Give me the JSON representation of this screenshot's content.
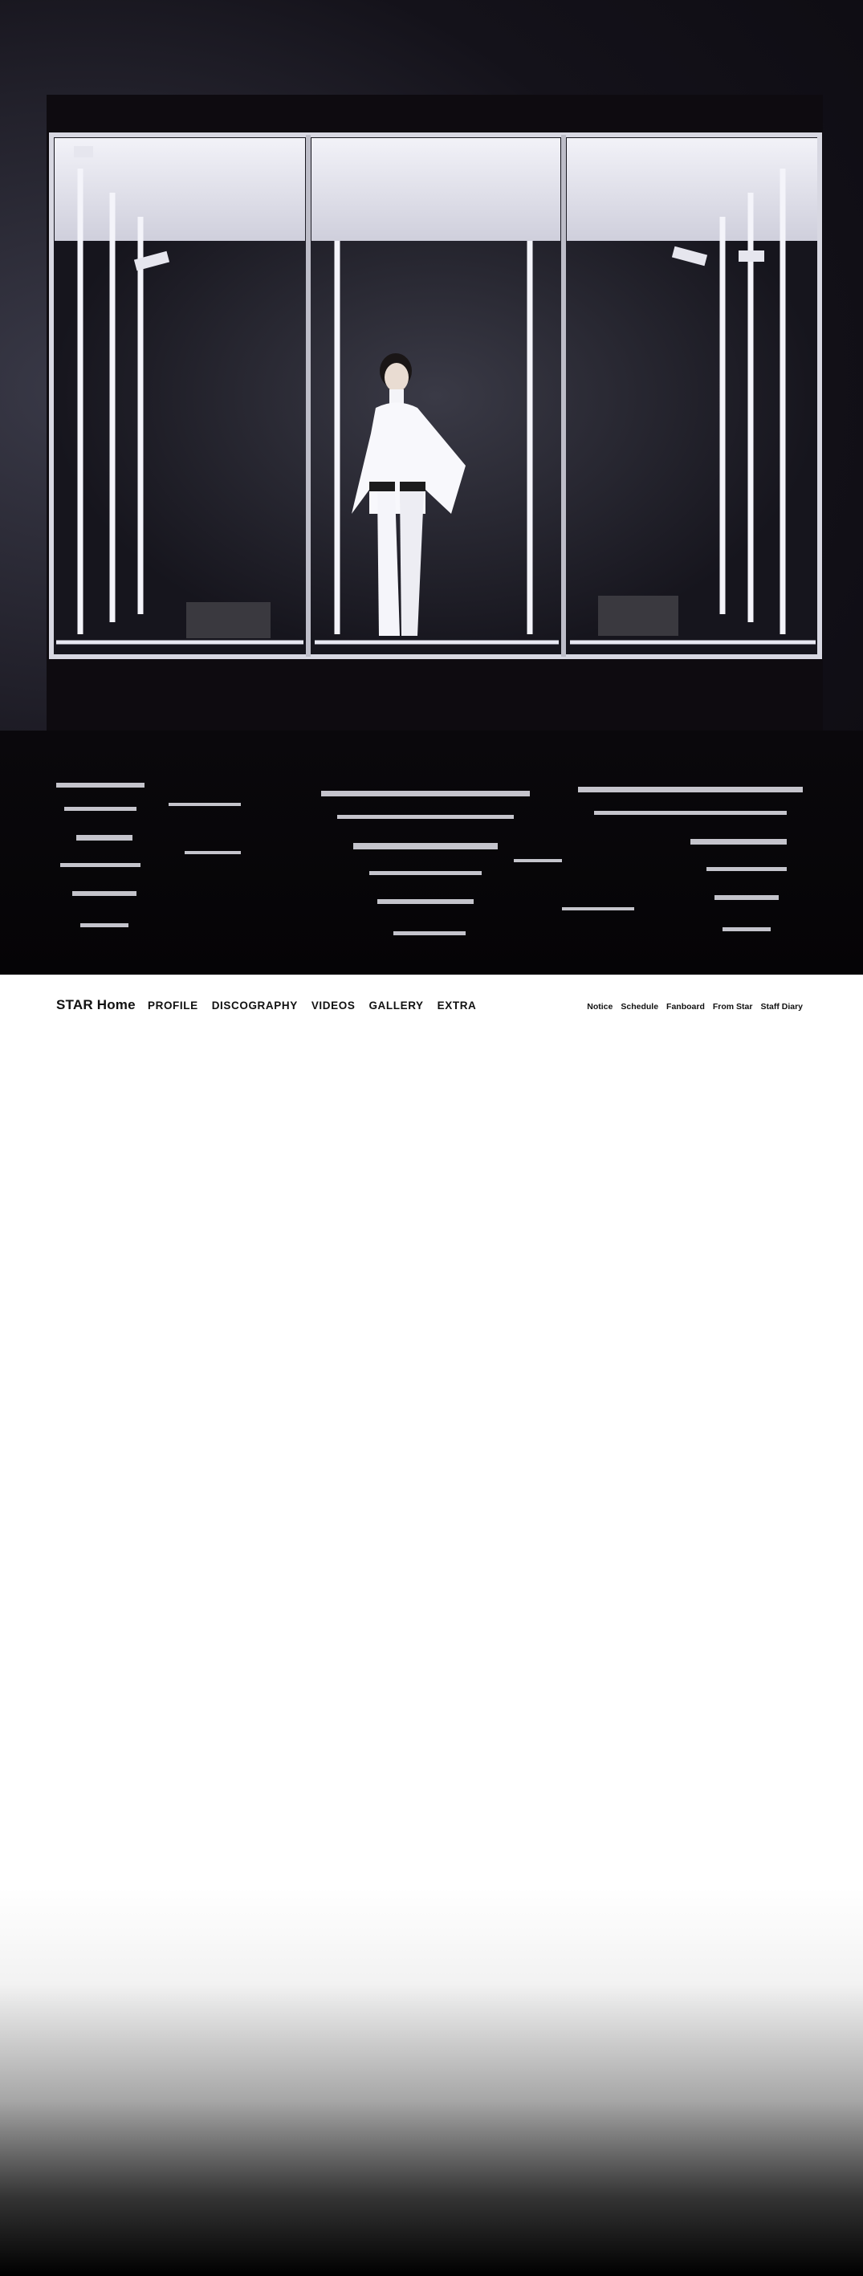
{
  "hero": {
    "image": "artist-photo-glass-box-over-water"
  },
  "header": {
    "brand": "STAR Home",
    "main_nav": [
      "PROFILE",
      "DISCOGRAPHY",
      "VIDEOS",
      "GALLERY",
      "EXTRA"
    ],
    "sub_nav": [
      "Notice",
      "Schedule",
      "Fanboard",
      "From Star",
      "Staff Diary"
    ]
  },
  "colors": {
    "background": "#ffffff",
    "text": "#111111",
    "footer_fade": "#000000"
  }
}
